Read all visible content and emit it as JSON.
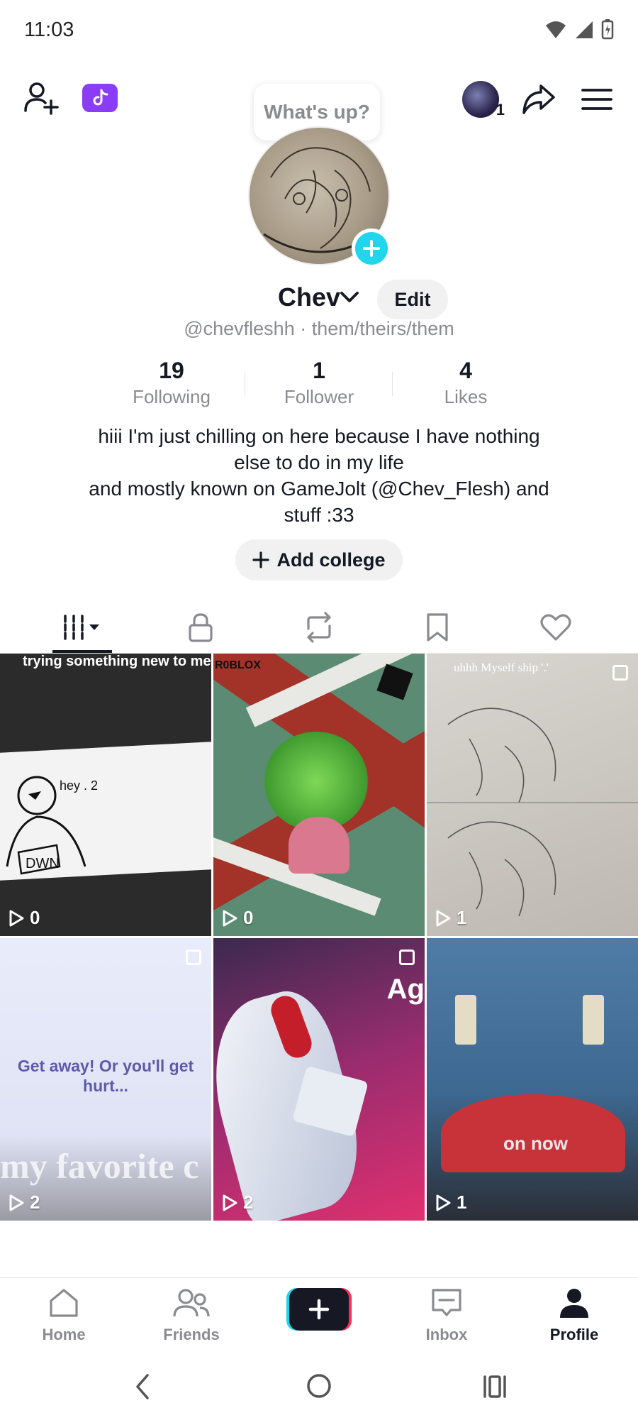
{
  "status_bar": {
    "time": "11:03"
  },
  "top_bar": {
    "bubble_text": "What's up?",
    "notification_count": "1"
  },
  "profile": {
    "display_name": "Chev",
    "edit_label": "Edit",
    "handle_line": "@chevfleshh · them/theirs/them",
    "stats": [
      {
        "value": "19",
        "label": "Following"
      },
      {
        "value": "1",
        "label": "Follower"
      },
      {
        "value": "4",
        "label": "Likes"
      }
    ],
    "bio_lines": [
      "hiii I'm just chilling on here because I have nothing",
      "else to do in my life",
      "and mostly known on GameJolt (@Chev_Flesh) and",
      "stuff :33"
    ],
    "add_college_label": "Add college"
  },
  "tabs": [
    "videos-icon",
    "lock-icon",
    "repost-icon",
    "bookmark-icon",
    "heart-icon"
  ],
  "videos": [
    {
      "views": "0",
      "caption": "trying something new to me"
    },
    {
      "views": "0",
      "caption": "R0BLOX"
    },
    {
      "views": "1",
      "caption": "uhhh Myself ship '.'"
    },
    {
      "views": "2",
      "caption": "Get away! Or you'll get hurt...",
      "caption2": "my favorite c"
    },
    {
      "views": "2",
      "caption": "Ag"
    },
    {
      "views": "1",
      "caption": "on now"
    }
  ],
  "bottom_nav": {
    "home": "Home",
    "friends": "Friends",
    "inbox": "Inbox",
    "profile": "Profile"
  },
  "colors": {
    "accent_cyan": "#20d5ec",
    "accent_red": "#fe2c55",
    "text_primary": "#161823",
    "text_secondary": "#8a8b91"
  }
}
